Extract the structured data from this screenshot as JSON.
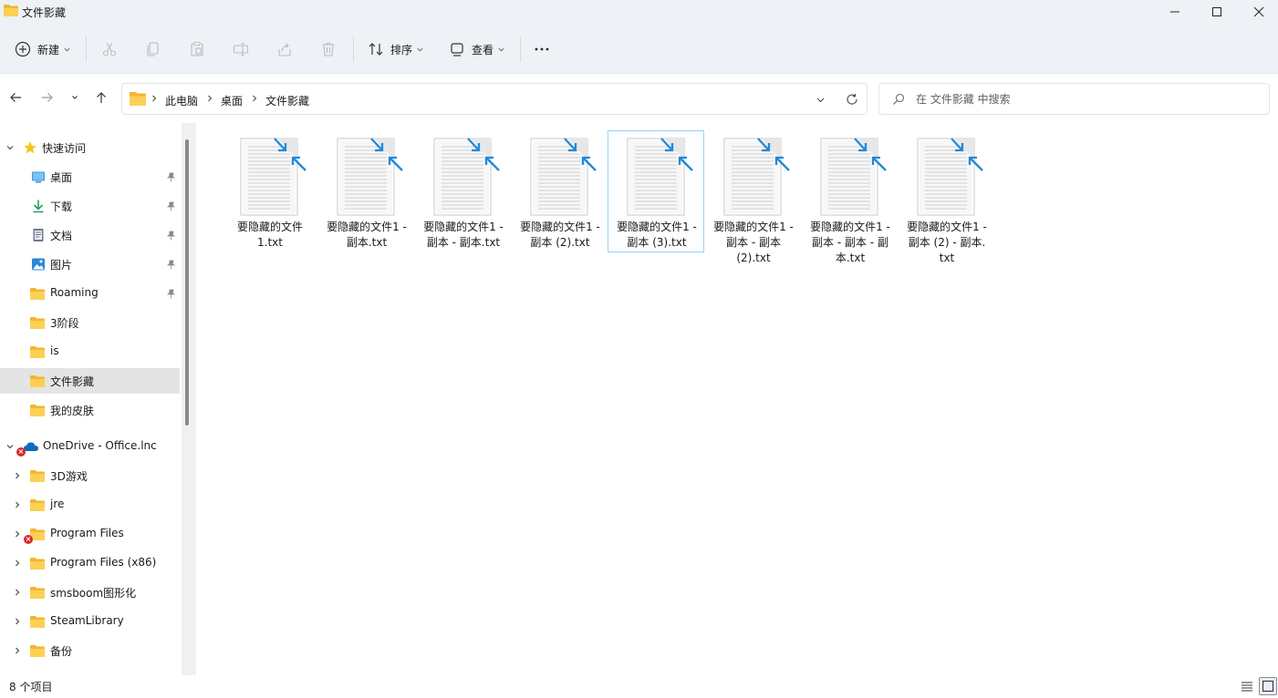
{
  "window": {
    "title": "文件影藏",
    "icon": "folder-icon",
    "controls": [
      "minimize-icon",
      "maximize-icon",
      "close-icon"
    ]
  },
  "toolbar": {
    "new_label": "新建",
    "sort_label": "排序",
    "view_label": "查看",
    "icons": [
      "add-icon",
      "cut-icon",
      "copy-icon",
      "paste-icon",
      "rename-icon",
      "share-icon",
      "delete-icon",
      "sort-icon",
      "view-icon",
      "more-icon"
    ]
  },
  "address": {
    "breadcrumbs": [
      "此电脑",
      "桌面",
      "文件影藏"
    ]
  },
  "search": {
    "placeholder": "在 文件影藏 中搜索"
  },
  "sidebar": {
    "quick_access": {
      "label": "快速访问",
      "items": [
        {
          "label": "桌面",
          "icon": "desktop-icon",
          "pinned": true
        },
        {
          "label": "下载",
          "icon": "download-icon",
          "pinned": true
        },
        {
          "label": "文档",
          "icon": "document-icon",
          "pinned": true
        },
        {
          "label": "图片",
          "icon": "picture-icon",
          "pinned": true
        },
        {
          "label": "Roaming",
          "icon": "folder-icon",
          "pinned": true
        },
        {
          "label": "3阶段",
          "icon": "folder-icon",
          "pinned": false
        },
        {
          "label": "is",
          "icon": "folder-icon",
          "pinned": false
        },
        {
          "label": "文件影藏",
          "icon": "folder-icon",
          "pinned": false,
          "selected": true
        },
        {
          "label": "我的皮肤",
          "icon": "folder-icon",
          "pinned": false
        }
      ]
    },
    "onedrive": {
      "label": "OneDrive - Office.lnc",
      "items": [
        {
          "label": "3D游戏",
          "error": false
        },
        {
          "label": "jre",
          "error": false
        },
        {
          "label": "Program Files",
          "error": true
        },
        {
          "label": "Program Files (x86)",
          "error": false
        },
        {
          "label": "smsboom图形化",
          "error": false
        },
        {
          "label": "SteamLibrary",
          "error": false
        },
        {
          "label": "备份",
          "error": false
        }
      ]
    }
  },
  "files": [
    {
      "name": "要隐藏的文件1.txt",
      "lines": [
        "要隐藏的文件",
        "1.txt"
      ]
    },
    {
      "name": "要隐藏的文件1 - 副本.txt",
      "lines": [
        "要隐藏的文件1 -",
        "副本.txt"
      ]
    },
    {
      "name": "要隐藏的文件1 - 副本 - 副本.txt",
      "lines": [
        "要隐藏的文件1 -",
        "副本 - 副本.txt"
      ]
    },
    {
      "name": "要隐藏的文件1 - 副本 (2).txt",
      "lines": [
        "要隐藏的文件1 -",
        "副本 (2).txt"
      ]
    },
    {
      "name": "要隐藏的文件1 - 副本 (3).txt",
      "lines": [
        "要隐藏的文件1 -",
        "副本 (3).txt"
      ],
      "selected": true
    },
    {
      "name": "要隐藏的文件1 - 副本 - 副本 (2).txt",
      "lines": [
        "要隐藏的文件1 -",
        "副本 - 副本",
        "(2).txt"
      ]
    },
    {
      "name": "要隐藏的文件1 - 副本 - 副本 - 副本.txt",
      "lines": [
        "要隐藏的文件1 -",
        "副本 - 副本 - 副",
        "本.txt"
      ]
    },
    {
      "name": "要隐藏的文件1 - 副本 (2) - 副本.txt",
      "lines": [
        "要隐藏的文件1 -",
        "副本 (2) - 副本.",
        "txt"
      ]
    }
  ],
  "status": {
    "item_count": "8 个项目"
  },
  "colors": {
    "chrome_bg": "#eef1f6",
    "folder_yellow": "#f7c948",
    "accent_blue": "#1f8ad8",
    "selection_border": "#99d1f4"
  }
}
